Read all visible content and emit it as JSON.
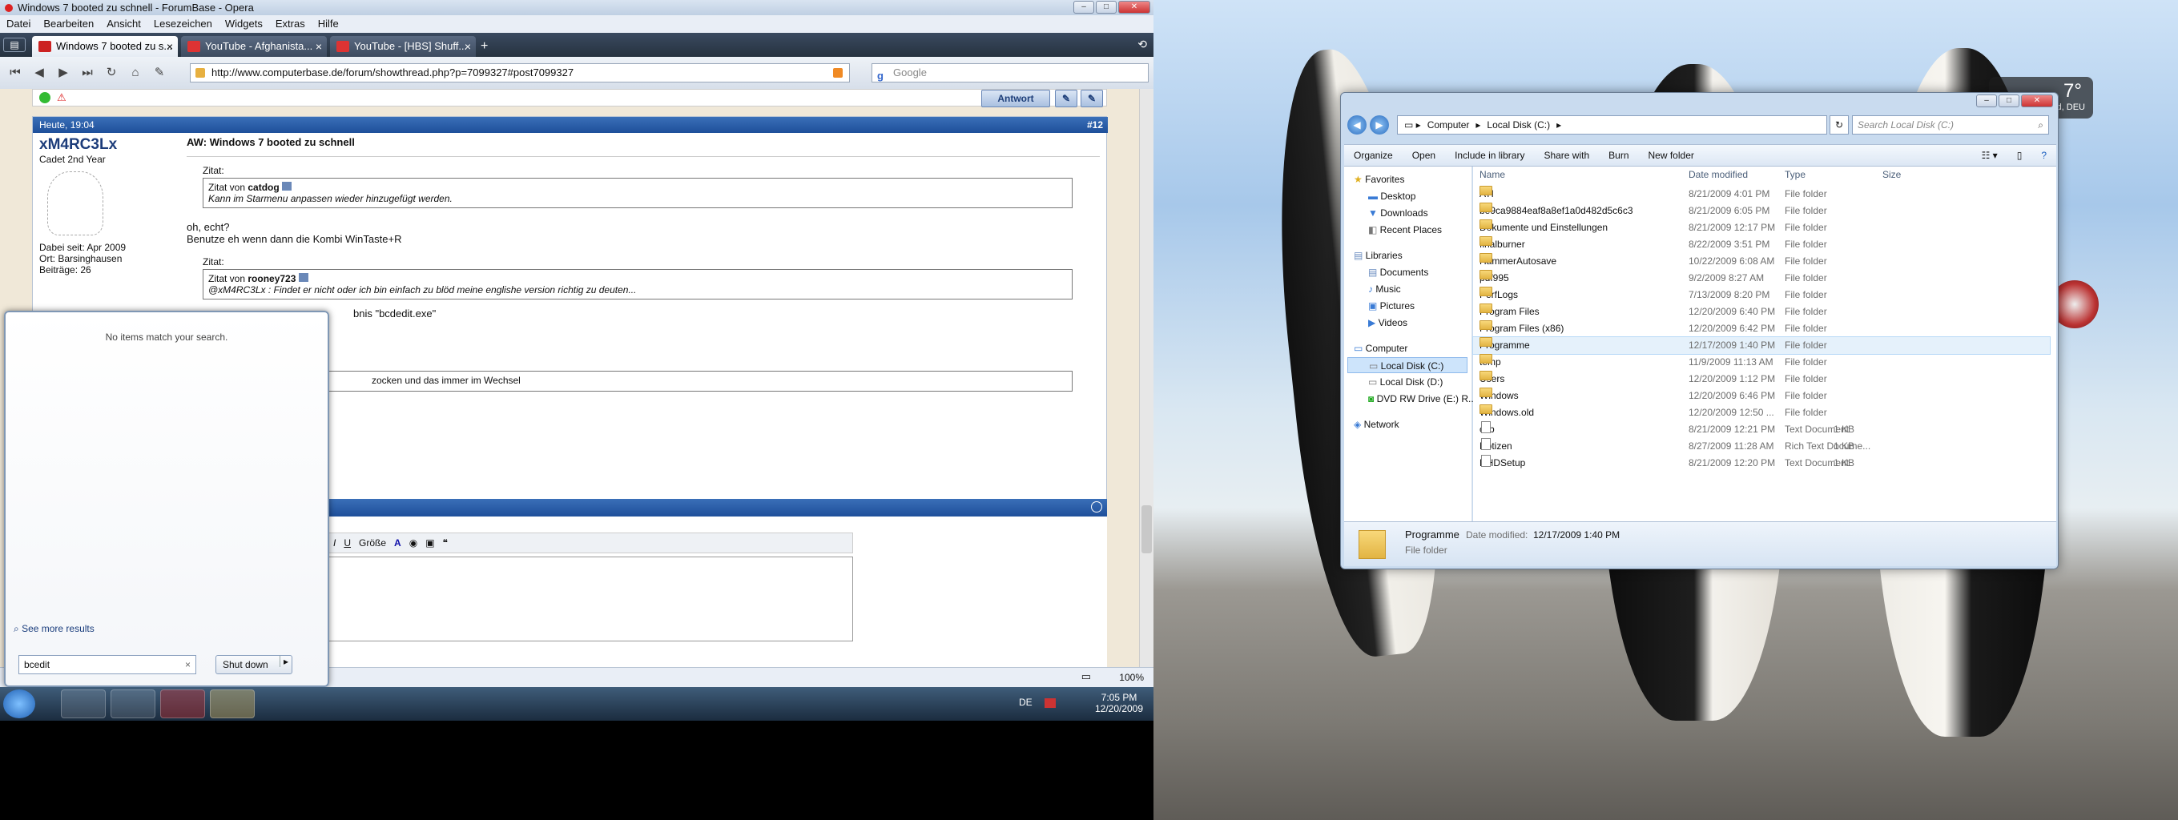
{
  "opera": {
    "title": "Windows 7 booted zu schnell - ForumBase - Opera",
    "menu": [
      "Datei",
      "Bearbeiten",
      "Ansicht",
      "Lesezeichen",
      "Widgets",
      "Extras",
      "Hilfe"
    ],
    "tabs": [
      "Windows 7 booted zu s...",
      "YouTube - Afghanista...",
      "YouTube - [HBS] Shuff..."
    ],
    "url": "http://www.computerbase.de/forum/showthread.php?p=7099327#post7099327",
    "search_placeholder": "Google",
    "zoom": "100%",
    "reply_label": "Antwort"
  },
  "post": {
    "date": "Heute, 19:04",
    "number": "#12",
    "author": "xM4RC3Lx",
    "rank": "Cadet 2nd Year",
    "joined": "Dabei seit: Apr 2009",
    "location": "Ort: Barsinghausen",
    "posts": "Beiträge: 26",
    "title": "AW: Windows 7 booted zu schnell",
    "quote1_label": "Zitat:",
    "quote1_from": "Zitat von",
    "quote1_author": "catdog",
    "quote1_text": "Kann im Starmenu anpassen wieder hinzugefügt werden.",
    "reply1_line1": "oh, echt?",
    "reply1_line2": "Benutze eh wenn dann die Kombi WinTaste+R",
    "quote2_label": "Zitat:",
    "quote2_from": "Zitat von",
    "quote2_author": "rooney723",
    "quote2_text": "@xM4RC3Lx : Findet er nicht oder ich bin einfach zu blöd meine englishe version richtig zu deuten...",
    "reply2_fragment": "bnis \"bcdedit.exe\"",
    "quote3_fragment": "zocken und das immer im Wechsel",
    "editor_size": "Größe"
  },
  "start_menu": {
    "no_items": "No items match your search.",
    "see_more": "See more results",
    "search_value": "bcedit",
    "shutdown": "Shut down"
  },
  "taskbar": {
    "lang": "DE",
    "time": "7:05 PM",
    "date": "12/20/2009"
  },
  "explorer": {
    "breadcrumb": [
      "Computer",
      "Local Disk (C:)"
    ],
    "search_placeholder": "Search Local Disk (C:)",
    "commands": [
      "Organize",
      "Open",
      "Include in library",
      "Share with",
      "Burn",
      "New folder"
    ],
    "nav": {
      "favorites": "Favorites",
      "fav_items": [
        "Desktop",
        "Downloads",
        "Recent Places"
      ],
      "libraries": "Libraries",
      "lib_items": [
        "Documents",
        "Music",
        "Pictures",
        "Videos"
      ],
      "computer": "Computer",
      "comp_items": [
        "Local Disk (C:)",
        "Local Disk (D:)",
        "DVD RW Drive (E:) R..."
      ],
      "network": "Network"
    },
    "columns": [
      "Name",
      "Date modified",
      "Type",
      "Size"
    ],
    "files": [
      {
        "name": "ATI",
        "date": "8/21/2009 4:01 PM",
        "type": "File folder",
        "size": "",
        "kind": "folder"
      },
      {
        "name": "be9ca9884eaf8a8ef1a0d482d5c6c3",
        "date": "8/21/2009 6:05 PM",
        "type": "File folder",
        "size": "",
        "kind": "folder"
      },
      {
        "name": "Dokumente und Einstellungen",
        "date": "8/21/2009 12:17 PM",
        "type": "File folder",
        "size": "",
        "kind": "folder"
      },
      {
        "name": "finalburner",
        "date": "8/22/2009 3:51 PM",
        "type": "File folder",
        "size": "",
        "kind": "folder"
      },
      {
        "name": "HammerAutosave",
        "date": "10/22/2009 6:08 AM",
        "type": "File folder",
        "size": "",
        "kind": "folder"
      },
      {
        "name": "pdf995",
        "date": "9/2/2009 8:27 AM",
        "type": "File folder",
        "size": "",
        "kind": "folder"
      },
      {
        "name": "PerfLogs",
        "date": "7/13/2009 8:20 PM",
        "type": "File folder",
        "size": "",
        "kind": "folder"
      },
      {
        "name": "Program Files",
        "date": "12/20/2009 6:40 PM",
        "type": "File folder",
        "size": "",
        "kind": "folder"
      },
      {
        "name": "Program Files (x86)",
        "date": "12/20/2009 6:42 PM",
        "type": "File folder",
        "size": "",
        "kind": "folder"
      },
      {
        "name": "Programme",
        "date": "12/17/2009 1:40 PM",
        "type": "File folder",
        "size": "",
        "kind": "folder"
      },
      {
        "name": "temp",
        "date": "11/9/2009 11:13 AM",
        "type": "File folder",
        "size": "",
        "kind": "folder"
      },
      {
        "name": "Users",
        "date": "12/20/2009 1:12 PM",
        "type": "File folder",
        "size": "",
        "kind": "folder"
      },
      {
        "name": "Windows",
        "date": "12/20/2009 6:46 PM",
        "type": "File folder",
        "size": "",
        "kind": "folder"
      },
      {
        "name": "Windows.old",
        "date": "12/20/2009 12:50 ...",
        "type": "File folder",
        "size": "",
        "kind": "folder"
      },
      {
        "name": "csb",
        "date": "8/21/2009 12:21 PM",
        "type": "Text Document",
        "size": "1 KB",
        "kind": "doc"
      },
      {
        "name": "Notizen",
        "date": "8/27/2009 11:28 AM",
        "type": "Rich Text Docume...",
        "size": "1 KB",
        "kind": "doc"
      },
      {
        "name": "RHDSetup",
        "date": "8/21/2009 12:20 PM",
        "type": "Text Document",
        "size": "1 KB",
        "kind": "doc"
      }
    ],
    "detail_name": "Programme",
    "detail_date_label": "Date modified:",
    "detail_date": "12/17/2009 1:40 PM",
    "detail_type": "File folder"
  },
  "gadget": {
    "temp": "7°",
    "loc": "ld, DEU"
  }
}
